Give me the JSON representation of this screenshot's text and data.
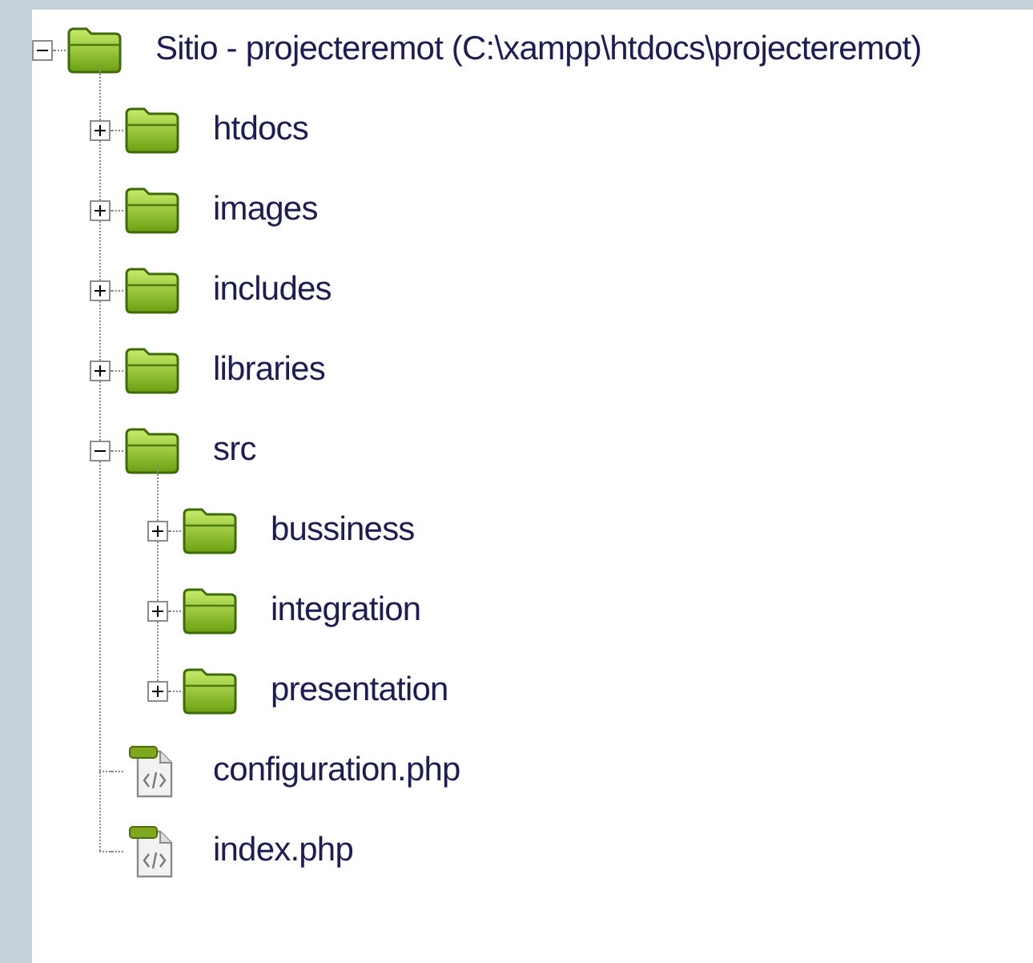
{
  "tree": {
    "kind": "folder",
    "label": "Sitio - projecteremot (C:\\xampp\\htdocs\\projecteremot)",
    "expanded": true,
    "children": [
      {
        "kind": "folder",
        "label": "htdocs",
        "expanded": false
      },
      {
        "kind": "folder",
        "label": "images",
        "expanded": false
      },
      {
        "kind": "folder",
        "label": "includes",
        "expanded": false
      },
      {
        "kind": "folder",
        "label": "libraries",
        "expanded": false
      },
      {
        "kind": "folder",
        "label": "src",
        "expanded": true,
        "children": [
          {
            "kind": "folder",
            "label": "bussiness",
            "expanded": false
          },
          {
            "kind": "folder",
            "label": "integration",
            "expanded": false
          },
          {
            "kind": "folder",
            "label": "presentation",
            "expanded": false
          }
        ]
      },
      {
        "kind": "file",
        "label": "configuration.php"
      },
      {
        "kind": "file",
        "label": "index.php"
      }
    ]
  }
}
